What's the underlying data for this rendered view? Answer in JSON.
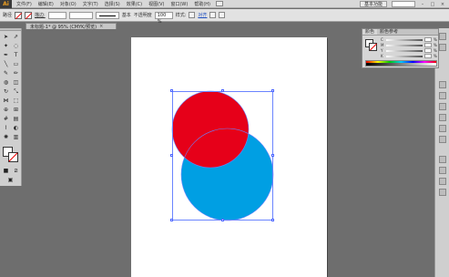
{
  "app": {
    "logo": "Ai"
  },
  "menu": {
    "items": [
      "文件(F)",
      "编辑(E)",
      "对象(O)",
      "文字(T)",
      "选择(S)",
      "效果(C)",
      "视图(V)",
      "窗口(W)",
      "帮助(H)"
    ],
    "workspace": "基本功能"
  },
  "controlbar": {
    "path_label": "路径",
    "stroke_label": "描边:",
    "stroke_style": "基本",
    "opacity_label": "不透明度",
    "opacity_value": "100 %",
    "style_label": "样式:",
    "align_link": "对齐"
  },
  "document": {
    "tab_title": "未标题-1* @ 95% (CMYK/预览)"
  },
  "canvas": {
    "shapes": [
      {
        "name": "red-circle",
        "fill": "#e60019"
      },
      {
        "name": "blue-circle",
        "fill": "#009fe3"
      }
    ],
    "selection_color": "#6a84ff"
  },
  "color_panel": {
    "tabs": [
      "颜色",
      "颜色参考"
    ],
    "channels": [
      {
        "label": "C",
        "unit": "%"
      },
      {
        "label": "M",
        "unit": "%"
      },
      {
        "label": "Y",
        "unit": "%"
      },
      {
        "label": "K",
        "unit": "%"
      }
    ]
  },
  "colors": {
    "accent_red": "#e60019",
    "accent_blue": "#009fe3",
    "ui_bg": "#6e6e6e"
  }
}
